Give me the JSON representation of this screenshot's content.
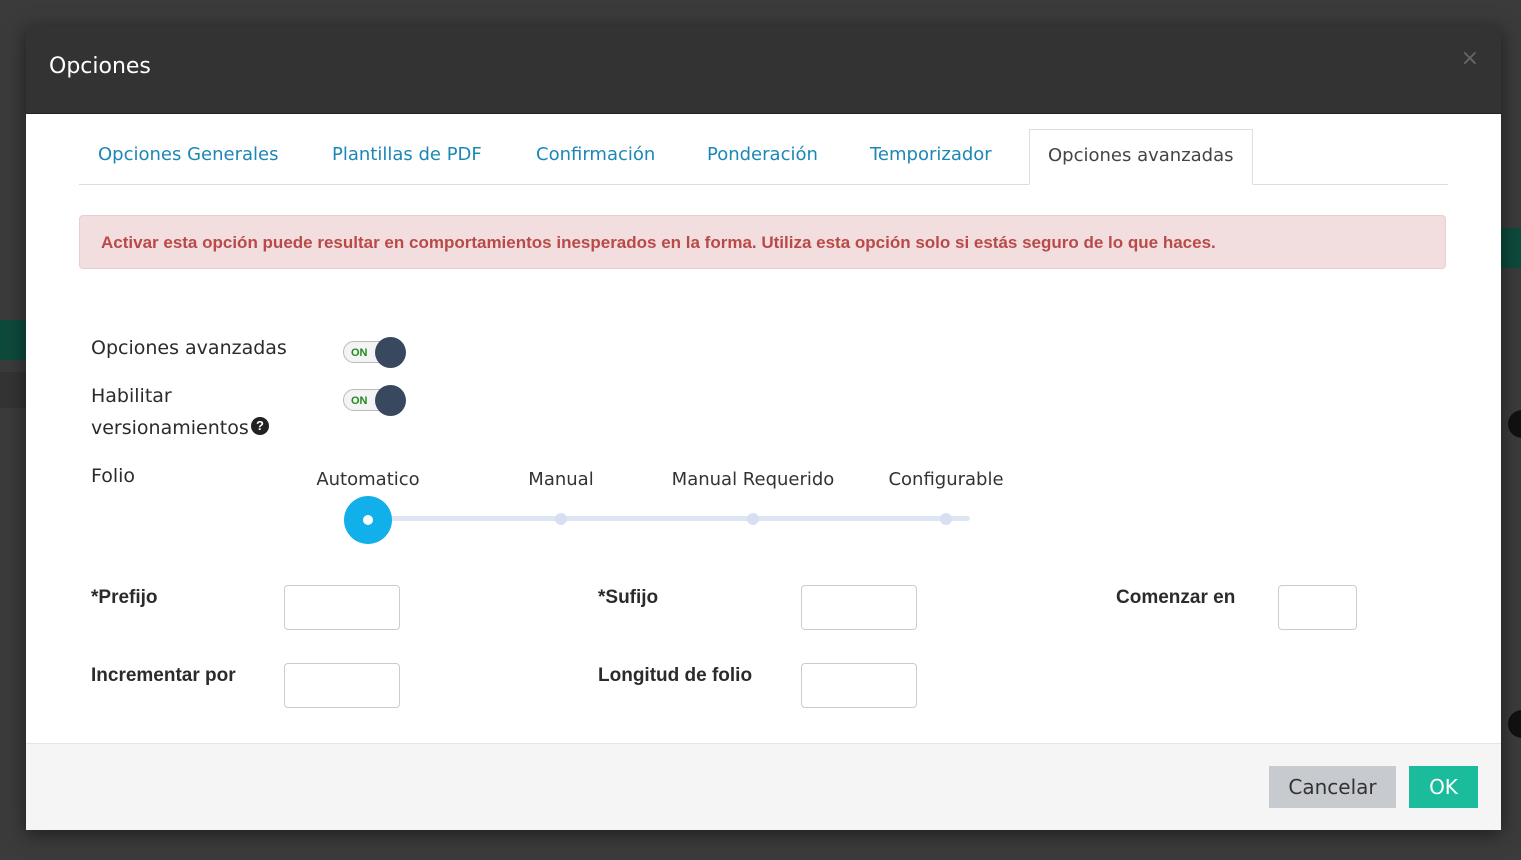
{
  "modal": {
    "title": "Opciones",
    "close_symbol": "×"
  },
  "tabs": [
    {
      "label": "Opciones Generales",
      "active": false
    },
    {
      "label": "Plantillas de PDF",
      "active": false
    },
    {
      "label": "Confirmación",
      "active": false
    },
    {
      "label": "Ponderación",
      "active": false
    },
    {
      "label": "Temporizador",
      "active": false
    },
    {
      "label": "Opciones avanzadas",
      "active": true
    }
  ],
  "alert": {
    "text": "Activar esta opción puede resultar en comportamientos inesperados en la forma. Utiliza esta opción solo si estás seguro de lo que haces."
  },
  "settings": {
    "advanced_options": {
      "label": "Opciones avanzadas",
      "state_text": "ON",
      "on": true
    },
    "versioning": {
      "label_line1": "Habilitar",
      "label_line2": "versionamientos",
      "help_symbol": "?",
      "state_text": "ON",
      "on": true
    }
  },
  "folio": {
    "label": "Folio",
    "options": [
      "Automatico",
      "Manual",
      "Manual Requerido",
      "Configurable"
    ],
    "selected": "Automatico"
  },
  "fields": {
    "prefix": {
      "label": "*Prefijo",
      "value": ""
    },
    "suffix": {
      "label": "*Sufijo",
      "value": ""
    },
    "start_at": {
      "label": "Comenzar en",
      "value": ""
    },
    "increment_by": {
      "label": "Incrementar por",
      "value": ""
    },
    "folio_length": {
      "label": "Longitud de folio",
      "value": ""
    }
  },
  "footer": {
    "cancel_label": "Cancelar",
    "ok_label": "OK"
  },
  "colors": {
    "header_bg": "#333333",
    "tab_link": "#1c87b7",
    "alert_bg": "#f2dede",
    "alert_text": "#b94a48",
    "toggle_knob": "#37485f",
    "slider_handle": "#12b0ea",
    "ok_button": "#1abc9c",
    "cancel_button": "#c7cbcf"
  }
}
